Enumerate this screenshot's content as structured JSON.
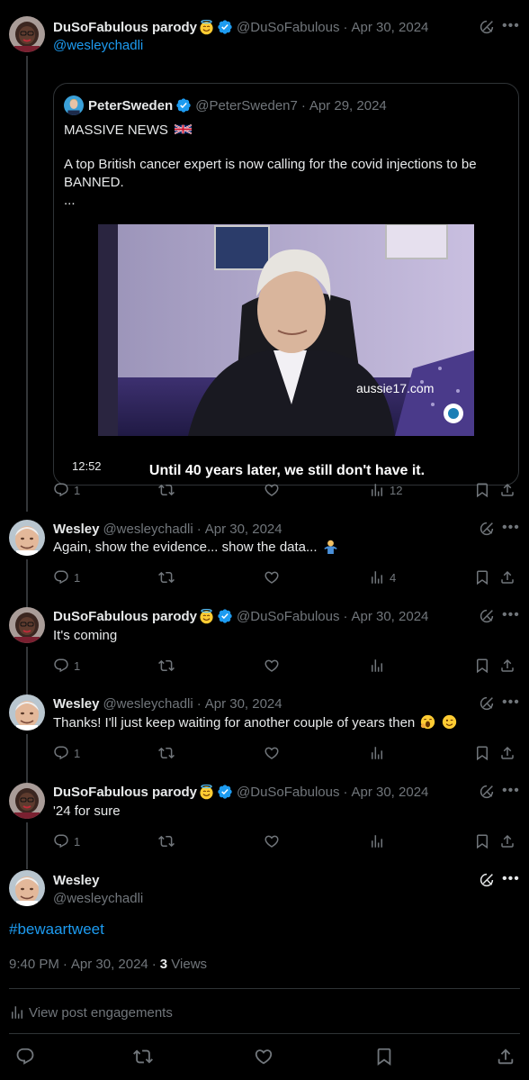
{
  "colors": {
    "background": "#000000",
    "text": "#e7e9ea",
    "muted": "#71767b",
    "link": "#1d9bf0",
    "border": "#2f3336",
    "verified": "#1d9bf0"
  },
  "posts": [
    {
      "name": "DuSoFabulous parody",
      "name_emoji": "smiling-face-with-halo",
      "verified": true,
      "handle": "@DuSoFabulous",
      "date": "Apr 30, 2024",
      "reply_to": "@wesleychadli",
      "quote": {
        "name": "PeterSweden",
        "verified": true,
        "handle": "@PeterSweden7",
        "date": "Apr 29, 2024",
        "line1": "MASSIVE NEWS",
        "flag_emoji": "uk-flag",
        "line2": "A top British cancer expert is now calling for the covid injections to be",
        "line3": "BANNED.",
        "line4": "...",
        "video": {
          "watermark": "aussie17.com",
          "caption": "Until 40 years later, we still don't have it.",
          "duration": "12:52"
        }
      },
      "stats": {
        "replies": "1",
        "reposts": "",
        "likes": "",
        "views": "12"
      }
    },
    {
      "name": "Wesley",
      "handle": "@wesleychadli",
      "date": "Apr 30, 2024",
      "text": "Again, show the evidence... show the data...",
      "text_emoji": "man-shrugging",
      "stats": {
        "replies": "1",
        "reposts": "",
        "likes": "",
        "views": "4"
      }
    },
    {
      "name": "DuSoFabulous parody",
      "name_emoji": "smiling-face-with-halo",
      "verified": true,
      "handle": "@DuSoFabulous",
      "date": "Apr 30, 2024",
      "text": "It's coming",
      "stats": {
        "replies": "1",
        "reposts": "",
        "likes": "",
        "views": ""
      }
    },
    {
      "name": "Wesley",
      "handle": "@wesleychadli",
      "date": "Apr 30, 2024",
      "text": "Thanks! I'll just keep waiting for another couple of years then",
      "text_emoji": "yawning-face winking-face",
      "stats": {
        "replies": "1",
        "reposts": "",
        "likes": "",
        "views": ""
      }
    },
    {
      "name": "DuSoFabulous parody",
      "name_emoji": "smiling-face-with-halo",
      "verified": true,
      "handle": "@DuSoFabulous",
      "date": "Apr 30, 2024",
      "text": "'24 for sure",
      "stats": {
        "replies": "1",
        "reposts": "",
        "likes": "",
        "views": ""
      }
    }
  ],
  "main": {
    "name": "Wesley",
    "handle": "@wesleychadli",
    "hashtag": "#bewaartweet",
    "time": "9:40 PM",
    "date": "Apr 30, 2024",
    "views_count": "3",
    "views_label": "Views",
    "engagements_label": "View post engagements"
  },
  "icons": [
    "grok-icon",
    "more-icon",
    "reply-icon",
    "repost-icon",
    "like-icon",
    "views-icon",
    "bookmark-icon",
    "share-icon",
    "verified-badge-icon"
  ]
}
